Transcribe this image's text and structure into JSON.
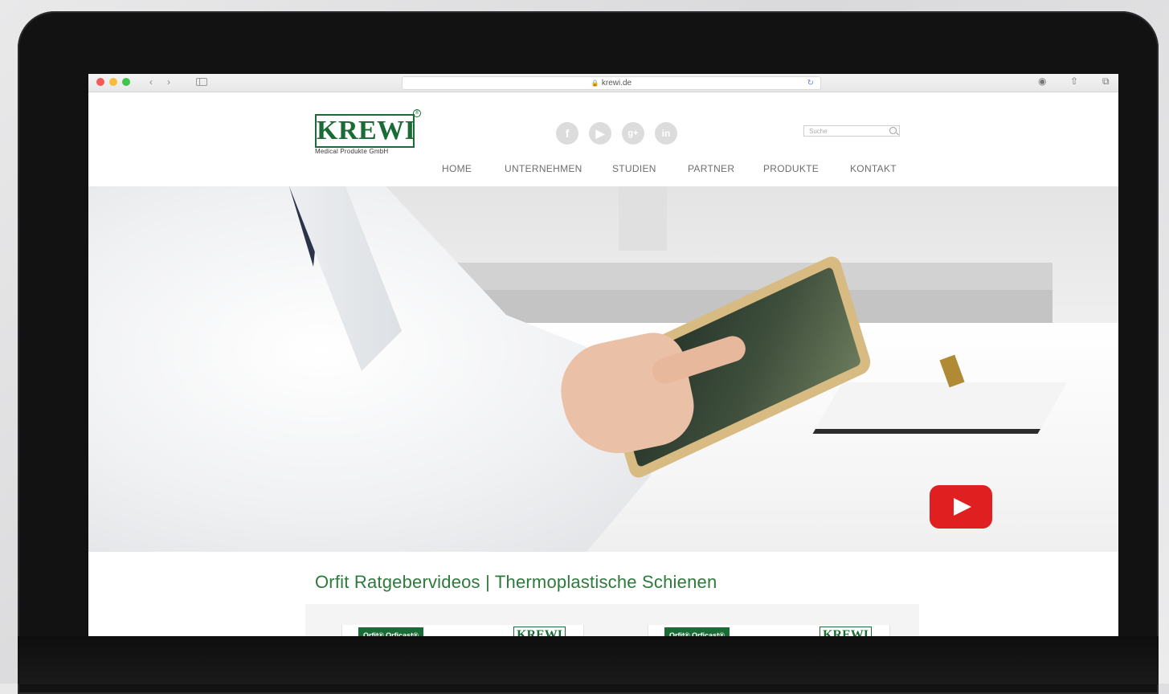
{
  "browser": {
    "url": "krewi.de",
    "back_icon": "chevron-left-icon",
    "forward_icon": "chevron-right-icon"
  },
  "site": {
    "logo": "KREWI",
    "logo_reg": "®",
    "logo_sub": "Medical Produkte GmbH",
    "search_placeholder": "Suche",
    "social": [
      "f",
      "▶",
      "g+",
      "in"
    ],
    "nav": [
      "HOME",
      "UNTERNEHMEN",
      "STUDIEN",
      "PARTNER",
      "PRODUKTE",
      "KONTAKT"
    ]
  },
  "colors": {
    "brand": "#1a6b35",
    "youtube": "#e02020"
  },
  "section": {
    "title": "Orfit Ratgebervideos | Thermoplastische Schienen"
  },
  "cards": [
    {
      "badge": "Orfit® Orficast®",
      "logo": "KREWI"
    },
    {
      "badge": "Orfit® Orficast®",
      "logo": "KREWI"
    }
  ]
}
